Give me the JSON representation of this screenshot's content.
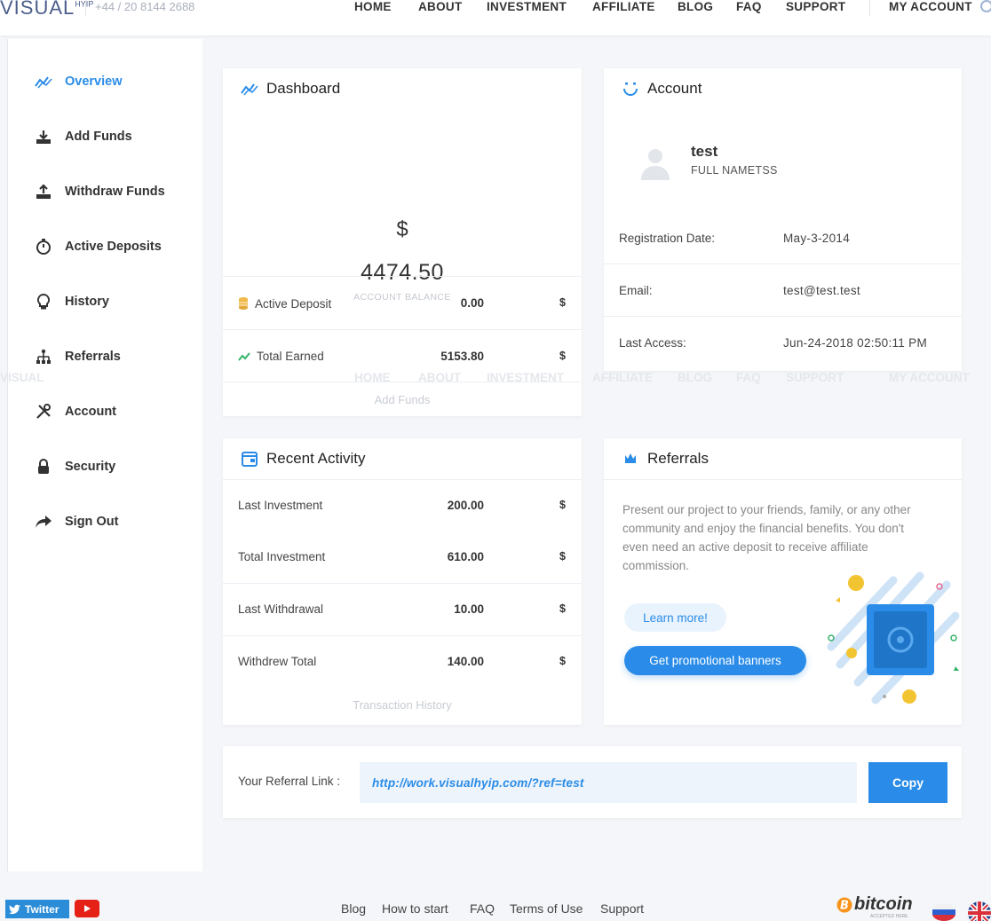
{
  "brand": {
    "logo": "VISUAL",
    "logo_sup": "HYIP",
    "phone": "+44 / 20 8144 2688"
  },
  "nav": {
    "items": [
      "HOME",
      "ABOUT",
      "INVESTMENT",
      "AFFILIATE",
      "BLOG",
      "FAQ",
      "SUPPORT"
    ],
    "account": "MY ACCOUNT"
  },
  "ghost_nav": {
    "logo_fragment": "VISUAL",
    "items": [
      "HOME",
      "ABOUT",
      "INVESTMENT",
      "AFFILIATE",
      "BLOG",
      "FAQ",
      "SUPPORT",
      "MY ACCOUNT"
    ]
  },
  "sidebar": {
    "items": [
      {
        "label": "Overview",
        "icon": "chart-line-icon",
        "active": true
      },
      {
        "label": "Add Funds",
        "icon": "download-icon",
        "active": false
      },
      {
        "label": "Withdraw Funds",
        "icon": "upload-icon",
        "active": false
      },
      {
        "label": "Active Deposits",
        "icon": "timer-icon",
        "active": false
      },
      {
        "label": "History",
        "icon": "lightbulb-icon",
        "active": false
      },
      {
        "label": "Referrals",
        "icon": "sitemap-icon",
        "active": false
      },
      {
        "label": "Account",
        "icon": "tools-icon",
        "active": false
      },
      {
        "label": "Security",
        "icon": "lock-icon",
        "active": false
      },
      {
        "label": "Sign Out",
        "icon": "share-arrow-icon",
        "active": false
      }
    ]
  },
  "dashboard": {
    "title": "Dashboard",
    "currency_symbol": "$",
    "balance": "4474.50",
    "balance_label": "ACCOUNT BALANCE",
    "rows": [
      {
        "label": "Active Deposit",
        "value": "0.00",
        "currency": "$",
        "icon": "coins-icon"
      },
      {
        "label": "Total Earned",
        "value": "5153.80",
        "currency": "$",
        "icon": "trend-up-icon"
      }
    ],
    "footer_link": "Add Funds"
  },
  "account": {
    "title": "Account",
    "username": "test",
    "full_name": "FULL NAMETSS",
    "fields": [
      {
        "label": "Registration Date:",
        "value": "May-3-2014"
      },
      {
        "label": "Email:",
        "value": "test@test.test"
      },
      {
        "label": "Last Access:",
        "value": "Jun-24-2018 02:50:11 PM"
      }
    ]
  },
  "recent_activity": {
    "title": "Recent Activity",
    "rows": [
      {
        "label": "Last Investment",
        "value": "200.00",
        "currency": "$"
      },
      {
        "label": "Total Investment",
        "value": "610.00",
        "currency": "$"
      },
      {
        "label": "Last Withdrawal",
        "value": "10.00",
        "currency": "$"
      },
      {
        "label": "Withdrew Total",
        "value": "140.00",
        "currency": "$"
      }
    ],
    "footer_link": "Transaction History"
  },
  "referrals": {
    "title": "Referrals",
    "text": "Present our project to your friends, family, or any other community and enjoy the financial benefits. You don't even need an active deposit to receive affiliate commission.",
    "learn_more": "Learn more!",
    "banners": "Get promotional banners"
  },
  "referral_link": {
    "label": "Your Referral Link :",
    "url": "http://work.visualhyip.com/?ref=test",
    "copy": "Copy"
  },
  "footer": {
    "twitter": "Twitter",
    "links": [
      "Blog",
      "How to start",
      "FAQ",
      "Terms of Use",
      "Support"
    ],
    "bitcoin": "bitcoin",
    "bitcoin_sub": "ACCEPTED HERE"
  },
  "colors": {
    "accent": "#2a8ce8",
    "text": "#333333",
    "muted": "#888888",
    "page_bg": "#f4f6f9"
  }
}
